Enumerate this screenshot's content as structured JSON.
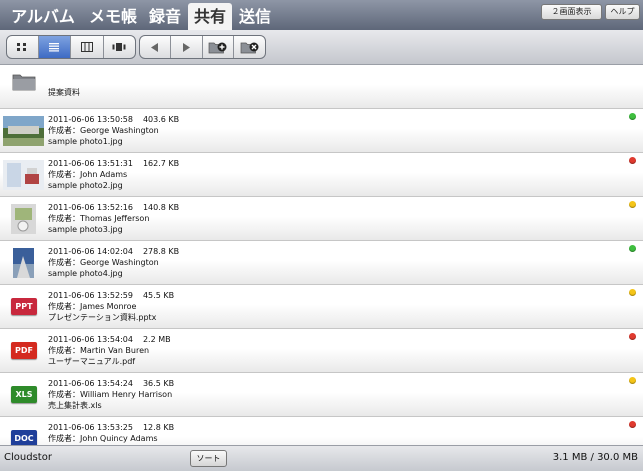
{
  "tabs": [
    {
      "label": "アルバム",
      "active": false
    },
    {
      "label": "メモ帳",
      "active": false
    },
    {
      "label": "録音",
      "active": false
    },
    {
      "label": "共有",
      "active": true
    },
    {
      "label": "送信",
      "active": false
    }
  ],
  "top_buttons": {
    "split_view": "２画面表示",
    "help": "ヘルプ"
  },
  "toolbar": {
    "view_modes": [
      "grid-view-icon",
      "list-view-icon",
      "columns-view-icon",
      "filmstrip-view-icon"
    ],
    "active_view": "list-view-icon",
    "nav": [
      "back-arrow-icon",
      "forward-arrow-icon",
      "new-folder-icon",
      "delete-folder-icon"
    ]
  },
  "folder": {
    "name": "提案資料",
    "icon": "folder-icon"
  },
  "files": [
    {
      "datetime": "2011-06-06 13:50:58",
      "size": "403.6 KB",
      "author": "作成者：George Washington",
      "filename": "sample photo1.jpg",
      "status_color": "#3fbf3f",
      "kind": "photo1"
    },
    {
      "datetime": "2011-06-06 13:51:31",
      "size": "162.7 KB",
      "author": "作成者：John Adams",
      "filename": "sample photo2.jpg",
      "status_color": "#e03a2f",
      "kind": "photo2"
    },
    {
      "datetime": "2011-06-06 13:52:16",
      "size": "140.8 KB",
      "author": "作成者：Thomas Jefferson",
      "filename": "sample photo3.jpg",
      "status_color": "#f5c518",
      "kind": "photo3"
    },
    {
      "datetime": "2011-06-06 14:02:04",
      "size": "278.8 KB",
      "author": "作成者：George Washington",
      "filename": "sample photo4.jpg",
      "status_color": "#3fbf3f",
      "kind": "photo4"
    },
    {
      "datetime": "2011-06-06 13:52:59",
      "size": "45.5 KB",
      "author": "作成者：James Monroe",
      "filename": "プレゼンテーション資料.pptx",
      "status_color": "#f5c518",
      "kind": "badge",
      "badge": "PPT",
      "badge_color": "#c8283d"
    },
    {
      "datetime": "2011-06-06 13:54:04",
      "size": "2.2 MB",
      "author": "作成者：Martin Van Buren",
      "filename": "ユーザーマニュアル.pdf",
      "status_color": "#e03a2f",
      "kind": "badge",
      "badge": "PDF",
      "badge_color": "#d42a1f"
    },
    {
      "datetime": "2011-06-06 13:54:24",
      "size": "36.5 KB",
      "author": "作成者：William Henry Harrison",
      "filename": "売上集計表.xls",
      "status_color": "#f5c518",
      "kind": "badge",
      "badge": "XLS",
      "badge_color": "#2e8b2a"
    },
    {
      "datetime": "2011-06-06 13:53:25",
      "size": "12.8 KB",
      "author": "作成者：John Quincy Adams",
      "filename": "",
      "status_color": "#e03a2f",
      "kind": "badge",
      "badge": "DOC",
      "badge_color": "#1f3f9a"
    }
  ],
  "bottom": {
    "brand": "Cloudstor",
    "sort_label": "ソート",
    "storage": "3.1 MB / 30.0 MB"
  }
}
